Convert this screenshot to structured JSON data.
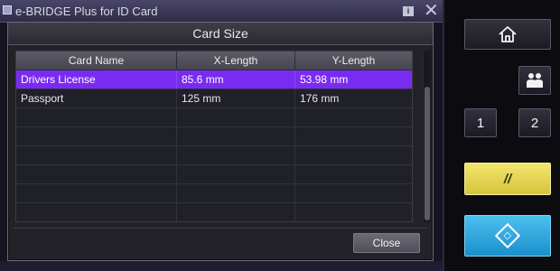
{
  "app": {
    "title": "e-BRIDGE Plus for ID Card",
    "info_icon_glyph": "i",
    "close_glyph": "✕"
  },
  "dialog": {
    "title": "Card Size",
    "columns": [
      "Card Name",
      "X-Length",
      "Y-Length"
    ],
    "rows": [
      {
        "name": "Drivers License",
        "x": "85.6 mm",
        "y": "53.98 mm",
        "selected": true
      },
      {
        "name": "Passport",
        "x": "125 mm",
        "y": "176 mm",
        "selected": false
      },
      {
        "name": "",
        "x": "",
        "y": "",
        "selected": false
      },
      {
        "name": "",
        "x": "",
        "y": "",
        "selected": false
      },
      {
        "name": "",
        "x": "",
        "y": "",
        "selected": false
      },
      {
        "name": "",
        "x": "",
        "y": "",
        "selected": false
      },
      {
        "name": "",
        "x": "",
        "y": "",
        "selected": false
      },
      {
        "name": "",
        "x": "",
        "y": "",
        "selected": false
      }
    ],
    "close_label": "Close",
    "selected_color": "#7a2bf2"
  },
  "side_panel": {
    "home_icon": "home-icon",
    "user_icon": "user-group-icon",
    "memory_1_label": "1",
    "memory_2_label": "2",
    "clear_label": "//",
    "clear_color": "#e4d24f",
    "start_icon": "start-diamond-icon",
    "start_color": "#2aa6dc"
  }
}
